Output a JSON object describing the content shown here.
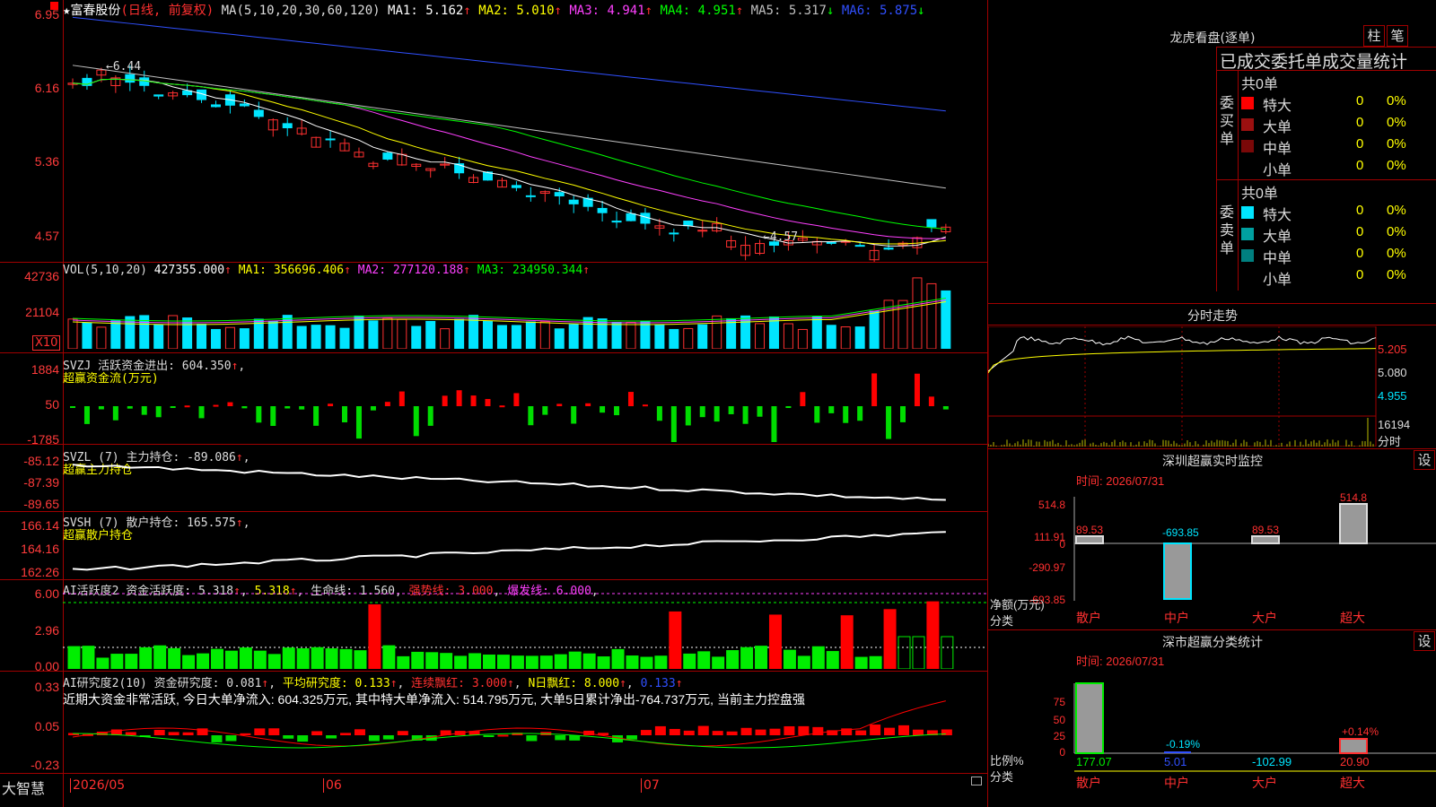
{
  "header": {
    "star": "★",
    "name": "富春股份",
    "mode": "(日线, 前复权)",
    "ma_def": "MA(5,10,20,30,60,120)",
    "ma": [
      {
        "label": "MA1: 5.162",
        "color": "#ffffff"
      },
      {
        "label": "MA2: 5.010",
        "color": "#ffff00"
      },
      {
        "label": "MA3: 4.941",
        "color": "#ff40ff"
      },
      {
        "label": "MA4: 4.951",
        "color": "#00ff00"
      },
      {
        "label": "MA5: 5.317",
        "color": "#c0c0c0"
      },
      {
        "label": "MA6: 5.875",
        "color": "#3050ff"
      }
    ],
    "up_arrow": "↑",
    "down_arrow": "↓"
  },
  "price_axis": [
    "6.95",
    "6.16",
    "5.36",
    "4.57"
  ],
  "price_marks": {
    "high": "6.44",
    "low": "4.57"
  },
  "vol": {
    "axis": [
      "42736",
      "21104"
    ],
    "unit_label": "X10",
    "title": "VOL(5,10,20)",
    "value": "427355.000",
    "ma": [
      {
        "label": "MA1: 356696.406",
        "color": "#ffff00"
      },
      {
        "label": "MA2: 277120.188",
        "color": "#ff40ff"
      },
      {
        "label": "MA3: 234950.344",
        "color": "#00ff00"
      }
    ]
  },
  "svzj": {
    "axis": [
      "1884",
      "50",
      "-1785"
    ],
    "title": "SVZJ  活跃资金进出: 604.350",
    "subtitle": "超赢资金流(万元)"
  },
  "svzl": {
    "axis": [
      "-85.12",
      "-87.39",
      "-89.65"
    ],
    "title": "SVZL (7) 主力持仓: -89.086",
    "subtitle": "超赢主力持仓"
  },
  "svsh": {
    "axis": [
      "166.14",
      "164.16",
      "162.26"
    ],
    "title": "SVSH (7) 散户持仓: 165.575",
    "subtitle": "超赢散户持仓"
  },
  "ai1": {
    "axis": [
      "6.00",
      "2.96",
      "0.00"
    ],
    "title": "AI活跃度2 资金活跃度: 5.318",
    "t2": "5.318",
    "t3": "生命线: 1.560",
    "t4": "强势线: 3.000",
    "t5": "爆发线: 6.000"
  },
  "ai2": {
    "axis": [
      "0.33",
      "0.05",
      "-0.23"
    ],
    "title": "AI研究度2(10) 资金研究度: 0.081",
    "t2": "平均研究度: 0.133",
    "t3": "连续飘红: 3.000",
    "t4": "N日飘红: 8.000",
    "t5": "0.133",
    "desc": "近期大资金非常活跃, 今日大单净流入: 604.325万元, 其中特大单净流入: 514.795万元, 大单5日累计净出-764.737万元, 当前主力控盘强"
  },
  "bottom": {
    "brand": "大智慧",
    "dates": [
      "2026/05",
      "06",
      "07"
    ]
  },
  "right": {
    "dragon_title": "龙虎看盘(逐单)",
    "btn_zhu": "柱",
    "btn_bi": "笔",
    "stat_title": "已成交委托单成交量统计",
    "buy": {
      "total": "共0单",
      "side": "委买单",
      "rows": [
        {
          "name": "特大",
          "v": "0",
          "p": "0%",
          "color": "#ff0000"
        },
        {
          "name": "大单",
          "v": "0",
          "p": "0%",
          "color": "#9b1010"
        },
        {
          "name": "中单",
          "v": "0",
          "p": "0%",
          "color": "#7a0808"
        },
        {
          "name": "小单",
          "v": "0",
          "p": "0%",
          "color": ""
        }
      ]
    },
    "sell": {
      "total": "共0单",
      "side": "委卖单",
      "rows": [
        {
          "name": "特大",
          "v": "0",
          "p": "0%",
          "color": "#00e5ff"
        },
        {
          "name": "大单",
          "v": "0",
          "p": "0%",
          "color": "#00a0a0"
        },
        {
          "name": "中单",
          "v": "0",
          "p": "0%",
          "color": "#008080"
        },
        {
          "name": "小单",
          "v": "0",
          "p": "0%",
          "color": ""
        }
      ]
    },
    "fenshi": {
      "title": "分时走势",
      "axis": [
        "5.205",
        "5.080",
        "4.955"
      ],
      "vol": "16194",
      "unit": "分时"
    },
    "sz_monitor": {
      "title": "深圳超赢实时监控",
      "btn": "设",
      "time": "时间: 2026/07/31",
      "axis": [
        "514.8",
        "111.91",
        "0",
        "-290.97",
        "-693.85"
      ],
      "labels": [
        "89.53",
        "-693.85",
        "89.53",
        "514.8"
      ],
      "cats": [
        "散户",
        "中户",
        "大户",
        "超大"
      ],
      "ylabel": "净额(万元)",
      "xlabel": "分类"
    },
    "sz_stats": {
      "title": "深市超赢分类统计",
      "btn": "设",
      "time": "时间: 2026/07/31",
      "axis": [
        "75",
        "50",
        "25",
        "0"
      ],
      "pct": [
        "-0.19%",
        "+0.14%"
      ],
      "vals": [
        "177.07",
        "5.01",
        "-102.99",
        "20.90"
      ],
      "cats": [
        "散户",
        "中户",
        "大户",
        "超大"
      ],
      "ylabel": "比例%",
      "xlabel": "分类"
    }
  }
}
